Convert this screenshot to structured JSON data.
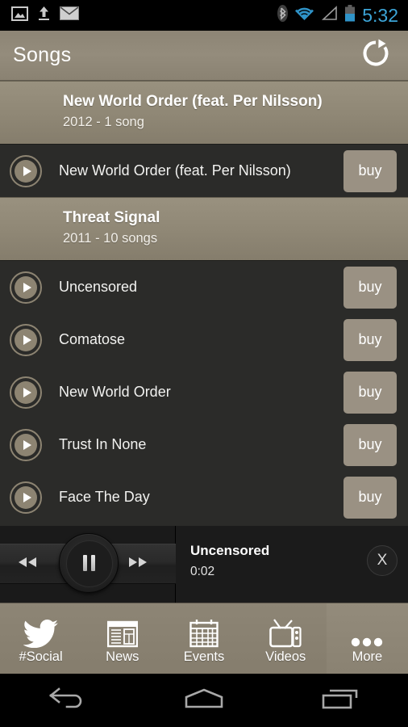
{
  "status_bar": {
    "time": "5:32",
    "time_color": "#3ca5d8",
    "left_icons": [
      "image-icon",
      "upload-icon",
      "email-icon"
    ],
    "right_icons": [
      "bluetooth-icon",
      "wifi-icon",
      "cell-signal-icon",
      "battery-icon"
    ]
  },
  "header": {
    "title": "Songs",
    "refresh_icon": "refresh-icon",
    "background_color": "#8f8777"
  },
  "list": {
    "background_color": "#2b2b29",
    "sections": [
      {
        "album": "New World Order (feat. Per Nilsson)",
        "meta": "2012 - 1 song",
        "songs": [
          {
            "title": "New World Order (feat. Per Nilsson)",
            "action": "buy"
          }
        ]
      },
      {
        "album": "Threat Signal",
        "meta": "2011 - 10 songs",
        "songs": [
          {
            "title": "Uncensored",
            "action": "buy"
          },
          {
            "title": "Comatose",
            "action": "buy"
          },
          {
            "title": "New World Order",
            "action": "buy"
          },
          {
            "title": "Trust In None",
            "action": "buy"
          },
          {
            "title": "Face The Day",
            "action": "buy"
          }
        ]
      }
    ]
  },
  "player": {
    "prev_icon": "rewind-icon",
    "pause_icon": "pause-icon",
    "next_icon": "fast-forward-icon",
    "now_playing_title": "Uncensored",
    "elapsed_time": "0:02",
    "close_label": "X"
  },
  "tabs": [
    {
      "label": "#Social",
      "icon": "twitter-bird-icon",
      "active": false
    },
    {
      "label": "News",
      "icon": "newspaper-icon",
      "active": false
    },
    {
      "label": "Events",
      "icon": "calendar-icon",
      "active": false
    },
    {
      "label": "Videos",
      "icon": "television-icon",
      "active": false
    },
    {
      "label": "More",
      "icon": "ellipsis-icon",
      "active": true
    }
  ],
  "nav_bar": {
    "back_icon": "back-arrow-icon",
    "home_icon": "home-icon",
    "recents_icon": "recent-apps-icon"
  }
}
